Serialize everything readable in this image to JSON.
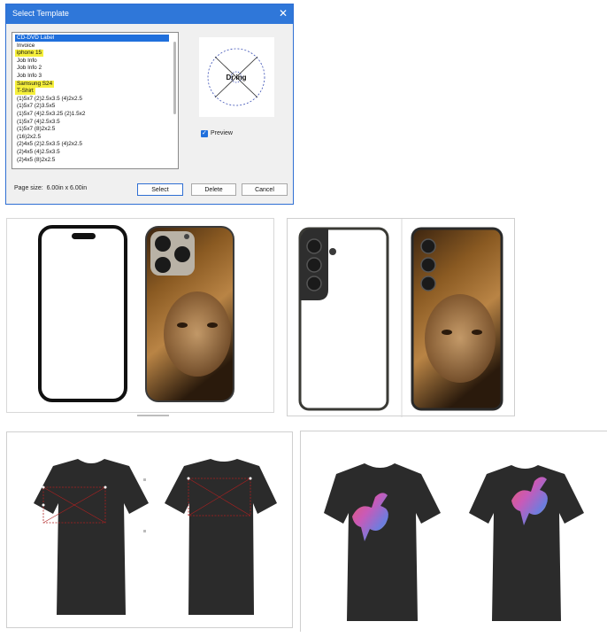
{
  "dialog": {
    "title": "Select Template",
    "close_glyph": "✕",
    "templates": [
      {
        "label": "CD-DVD Label",
        "state": "selected"
      },
      {
        "label": "Invoice",
        "state": ""
      },
      {
        "label": "iphone 15",
        "state": "highlight"
      },
      {
        "label": "Job Info",
        "state": ""
      },
      {
        "label": "Job Info 2",
        "state": ""
      },
      {
        "label": "Job Info 3",
        "state": ""
      },
      {
        "label": "Samsung S24",
        "state": "highlight"
      },
      {
        "label": "T-Shirt",
        "state": "highlight"
      },
      {
        "label": "(1)5x7 (2)2.5x3.5 (4)2x2.5",
        "state": ""
      },
      {
        "label": "(1)5x7 (2)3.5x5",
        "state": ""
      },
      {
        "label": "(1)5x7 (4)2.5x3.25 (2)1.5x2",
        "state": ""
      },
      {
        "label": "(1)5x7 (4)2.5x3.5",
        "state": ""
      },
      {
        "label": "(1)5x7 (8)2x2.5",
        "state": ""
      },
      {
        "label": "(16)2x2.5",
        "state": ""
      },
      {
        "label": "(2)4x5 (2)2.5x3.5 (4)2x2.5",
        "state": ""
      },
      {
        "label": "(2)4x5 (4)2.5x3.5",
        "state": ""
      },
      {
        "label": "(2)4x5 (8)2x2.5",
        "state": ""
      }
    ],
    "preview_label": "Preview",
    "preview_checked": true,
    "preview_glyph_text": "Dr ing",
    "page_size_label": "Page size:",
    "page_size_value": "6.00in x 6.00in",
    "buttons": {
      "select": "Select",
      "delete": "Delete",
      "cancel": "Cancel"
    }
  },
  "colors": {
    "accent": "#2f77d9",
    "selection": "#1f6fdc",
    "highlight": "#f5ef3c",
    "shirt": "#2b2b2b",
    "template_guides": "#b02020"
  }
}
